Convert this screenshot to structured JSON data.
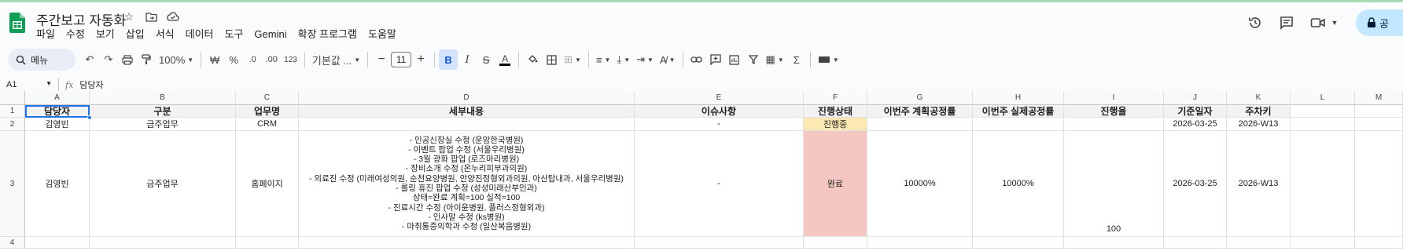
{
  "app": {
    "doc_title": "주간보고 자동화",
    "menu": [
      "파일",
      "수정",
      "보기",
      "삽입",
      "서식",
      "데이터",
      "도구",
      "Gemini",
      "확장 프로그램",
      "도움말"
    ],
    "share_label": "공"
  },
  "toolbar": {
    "search_label": "메뉴",
    "zoom": "100%",
    "currency": "₩",
    "percent": "%",
    "dec_decrease": ".0",
    "dec_increase": ".00",
    "number_format": "123",
    "font": "기본값 ...",
    "font_size": "11"
  },
  "formula_bar": {
    "cell_ref": "A1",
    "fx": "fx",
    "content": "담당자"
  },
  "grid": {
    "columns": [
      "A",
      "B",
      "C",
      "D",
      "E",
      "F",
      "G",
      "H",
      "I",
      "J",
      "K",
      "L",
      "M"
    ],
    "rows": [
      "1",
      "2",
      "3",
      "4"
    ],
    "header": [
      "담당자",
      "구분",
      "업무명",
      "세부내용",
      "이슈사항",
      "진행상태",
      "이번주 계획공정률",
      "이번주 실제공정률",
      "진행율",
      "기준일자",
      "주차키"
    ],
    "row2": [
      "김영빈",
      "금주업무",
      "CRM",
      "",
      "-",
      "진행중",
      "",
      "",
      "",
      "2026-03-25",
      "2026-W13"
    ],
    "row3": [
      "김영빈",
      "금주업무",
      "홈페이지",
      "",
      "-",
      "완료",
      "10000%",
      "10000%",
      "100",
      "2026-03-25",
      "2026-W13"
    ],
    "row3_details": [
      "- 인공신장실 수정 (운암한국병원)",
      "- 이벤트 팝업 수정 (서울우리병원)",
      "- 3월 광화 팝업 (로즈마리병원)",
      "- 장비소개 수정 (온누리피부과의원)",
      "- 의료진 수정 (미래여성의원, 순천요양병원, 안양진정형외과의원, 아산탑내과, 서울우리병원)",
      "- 롤링 휴진 팝업 수정 (성성미래산부인과)",
      "상태=완료 계획=100 실적=100",
      "- 진료시간 수정 (아이윤병원, 플러스정형외과)",
      "- 인사말 수정 (ks병원)",
      "- 마취통증의학과 수정 (일산복음병원)"
    ]
  },
  "colors": {
    "status_in_progress": "#fce8b2",
    "status_done": "#f4c7c3",
    "accent": "#0b57d0"
  }
}
